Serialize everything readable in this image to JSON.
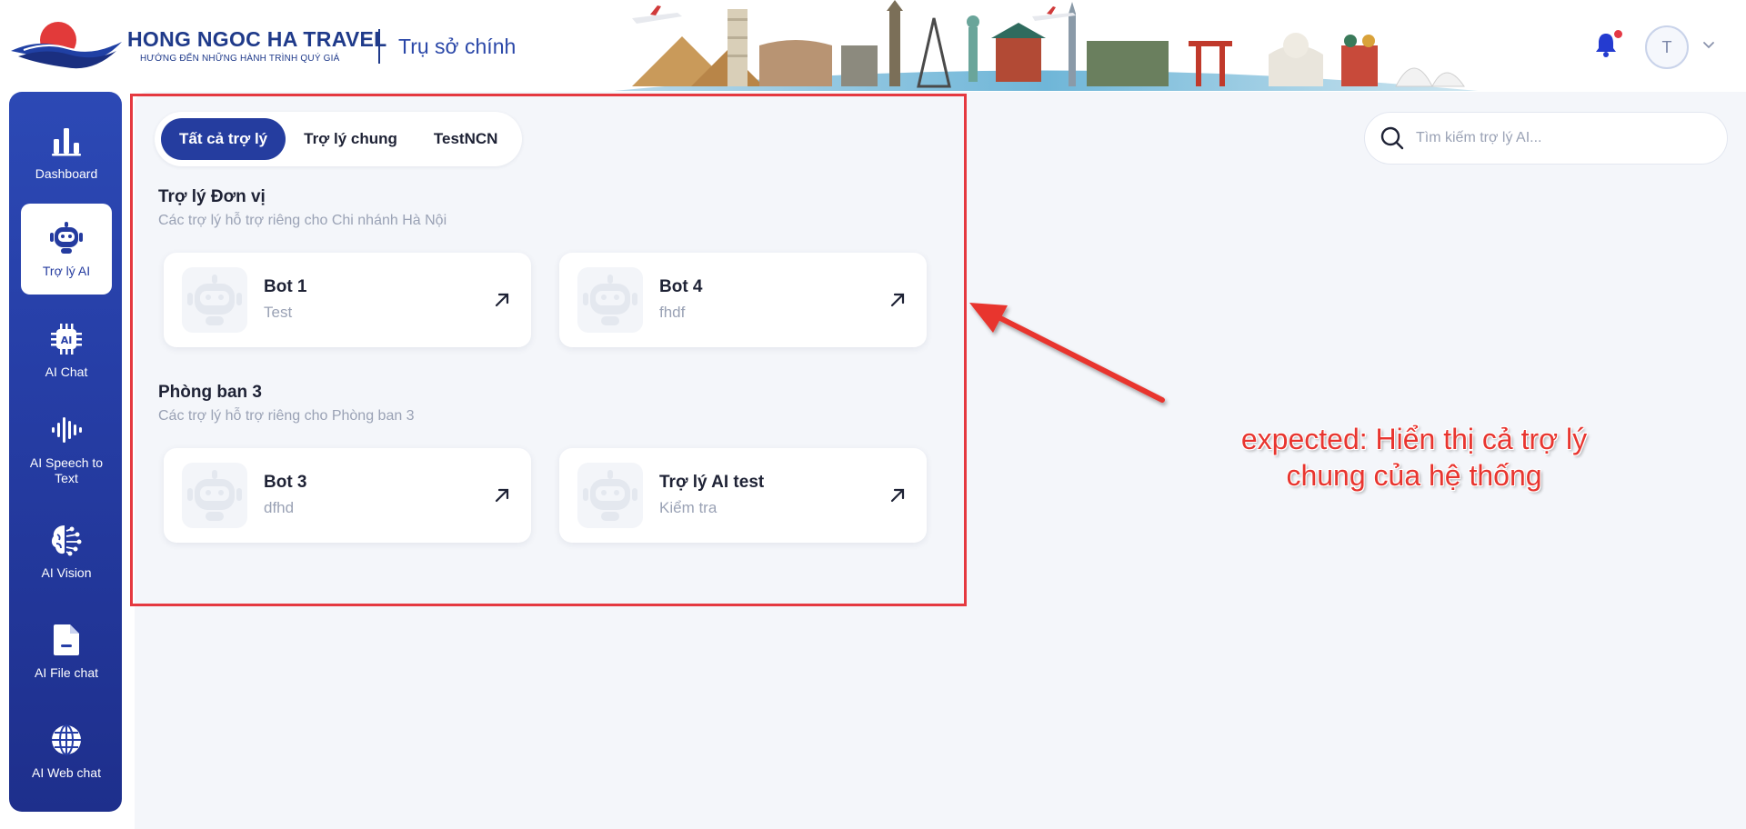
{
  "header": {
    "brand_name": "HONG NGOC HA TRAVEL",
    "brand_slogan": "HƯỚNG ĐẾN NHỮNG HÀNH TRÌNH QUÝ GIÁ",
    "office": "Trụ sở chính",
    "avatar_initial": "T"
  },
  "sidebar": {
    "items": [
      {
        "label": "Dashboard",
        "icon": "bar-chart-icon"
      },
      {
        "label": "Trợ lý AI",
        "icon": "robot-icon"
      },
      {
        "label": "AI Chat",
        "icon": "ai-chip-icon"
      },
      {
        "label": "AI Speech to Text",
        "icon": "sound-wave-icon"
      },
      {
        "label": "AI Vision",
        "icon": "brain-icon"
      },
      {
        "label": "AI File chat",
        "icon": "file-icon"
      },
      {
        "label": "AI Web chat",
        "icon": "globe-icon"
      }
    ]
  },
  "tabs": [
    {
      "label": "Tất cả trợ lý"
    },
    {
      "label": "Trợ lý chung"
    },
    {
      "label": "TestNCN"
    }
  ],
  "search": {
    "placeholder": "Tìm kiếm trợ lý AI..."
  },
  "sections": [
    {
      "title": "Trợ lý Đơn vị",
      "subtitle": "Các trợ lý hỗ trợ riêng cho Chi nhánh Hà Nội",
      "cards": [
        {
          "name": "Bot 1",
          "desc": "Test"
        },
        {
          "name": "Bot 4",
          "desc": "fhdf"
        }
      ]
    },
    {
      "title": "Phòng ban 3",
      "subtitle": "Các trợ lý hỗ trợ riêng cho Phòng ban 3",
      "cards": [
        {
          "name": "Bot 3",
          "desc": "dfhd"
        },
        {
          "name": "Trợ lý AI test",
          "desc": "Kiểm tra"
        }
      ]
    }
  ],
  "annotation": {
    "line1": "expected: Hiển thị cả trợ lý",
    "line2": "chung của hệ thống",
    "color": "#e8352f"
  },
  "colors": {
    "brand": "#1f3a8a",
    "accent": "#253d9f",
    "highlight": "#e53940"
  }
}
